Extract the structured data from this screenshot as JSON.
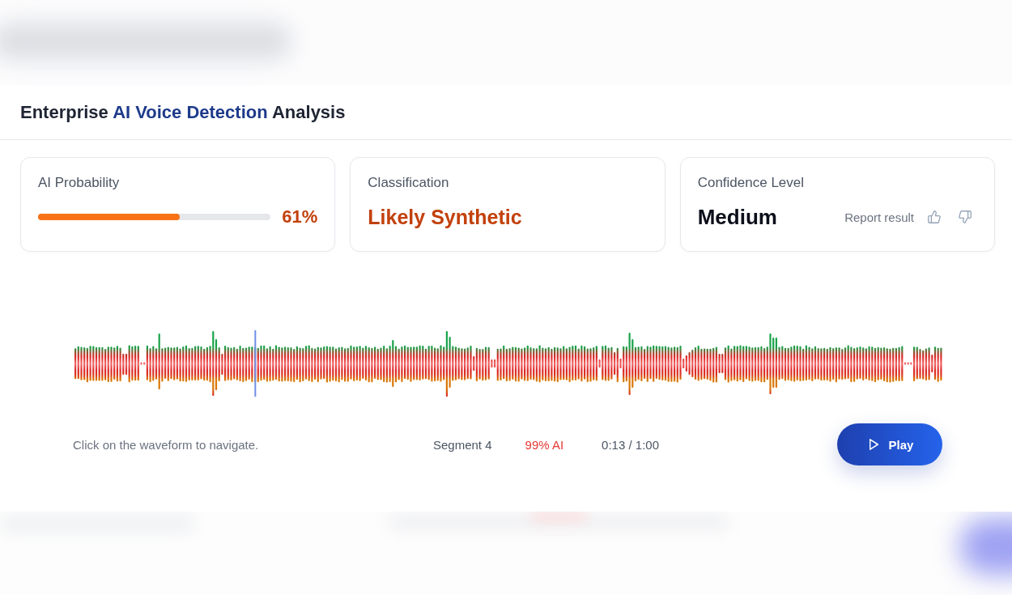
{
  "header": {
    "title_parts": [
      {
        "text": "Enterprise",
        "highlight": false
      },
      {
        "text": "AI Voice Detection",
        "highlight": true
      },
      {
        "text": "Analysis",
        "highlight": false
      }
    ]
  },
  "metrics": [
    {
      "kind": "probability",
      "label": "AI Probability",
      "level": 0.61,
      "value": "61%"
    },
    {
      "kind": "classification",
      "label": "Classification",
      "value": "Likely Synthetic"
    },
    {
      "kind": "confidence",
      "label": "Confidence Level",
      "value": "Medium",
      "feedback": {
        "label": "Report result"
      }
    }
  ],
  "waveform": {
    "playhead": {
      "level": 0.21
    }
  },
  "player": {
    "hint": "Click on the waveform to navigate.",
    "segment": "Segment 4",
    "segment_score": "99% AI",
    "time": "0:13 / 1:00",
    "play_button": {
      "label": "Play"
    }
  }
}
